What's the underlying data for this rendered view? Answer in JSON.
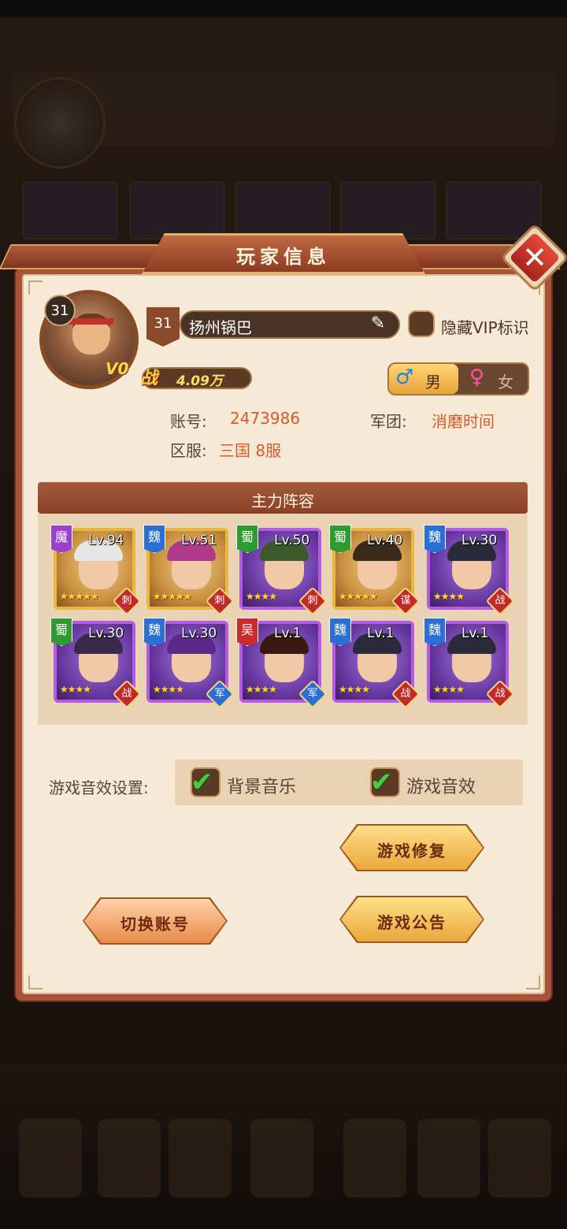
{
  "dialog": {
    "title": "玩家信息",
    "close_label": "✕"
  },
  "player": {
    "level": "31",
    "badge_level": "31",
    "vip": "V0",
    "name": "扬州锅巴",
    "hide_vip_label": "隐藏VIP标识",
    "power_icon": "战",
    "power": "4.09万",
    "gender_male_icon": "♂",
    "gender_male": "男",
    "gender_female_icon": "♀",
    "gender_female": "女",
    "account_label": "账号:",
    "account_value": "2473986",
    "legion_label": "军团:",
    "legion_value": "消磨时间",
    "server_label": "区服:",
    "server_value": "三国 8服"
  },
  "lineup": {
    "title": "主力阵容",
    "heroes": [
      {
        "faction": "魔",
        "level": "Lv.94",
        "stars": "★★★★★",
        "role": "刺"
      },
      {
        "faction": "魏",
        "level": "Lv.51",
        "stars": "★★★★★",
        "role": "刺"
      },
      {
        "faction": "蜀",
        "level": "Lv.50",
        "stars": "★★★★",
        "role": "刺"
      },
      {
        "faction": "蜀",
        "level": "Lv.40",
        "stars": "★★★★★",
        "role": "谋"
      },
      {
        "faction": "魏",
        "level": "Lv.30",
        "stars": "★★★★",
        "role": "战"
      },
      {
        "faction": "蜀",
        "level": "Lv.30",
        "stars": "★★★★",
        "role": "战"
      },
      {
        "faction": "魏",
        "level": "Lv.30",
        "stars": "★★★★",
        "role": "军"
      },
      {
        "faction": "吴",
        "level": "Lv.1",
        "stars": "★★★★",
        "role": "军"
      },
      {
        "faction": "魏",
        "level": "Lv.1",
        "stars": "★★★★",
        "role": "战"
      },
      {
        "faction": "魏",
        "level": "Lv.1",
        "stars": "★★★★",
        "role": "战"
      }
    ]
  },
  "sound": {
    "label": "游戏音效设置:",
    "bgm_label": "背景音乐",
    "sfx_label": "游戏音效",
    "check_glyph": "✔"
  },
  "buttons": {
    "repair": "游戏修复",
    "switch_account": "切换账号",
    "announcement": "游戏公告"
  },
  "icons": {
    "edit": "✎"
  }
}
